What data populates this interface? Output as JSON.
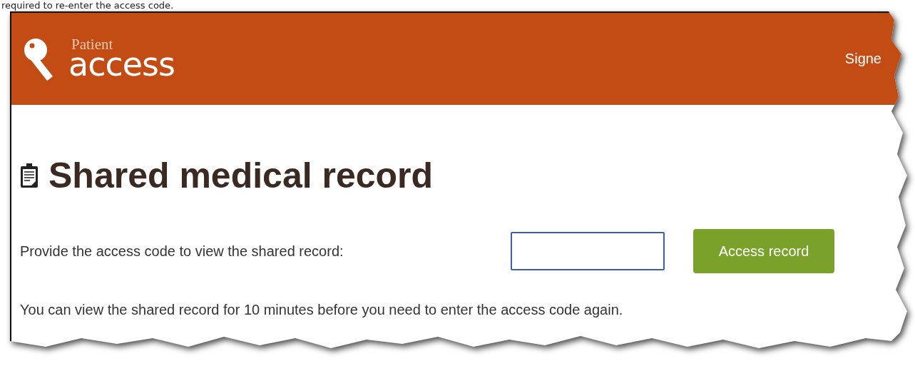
{
  "caption": "required to re-enter the access code.",
  "header": {
    "logo_small": "Patient",
    "logo_large": "access",
    "user": "Signe"
  },
  "title": "Shared medical record",
  "form": {
    "label": "Provide the access code to view the shared record:",
    "button": "Access record"
  },
  "note": "You can view the shared record for 10 minutes before you need to enter the access code again."
}
